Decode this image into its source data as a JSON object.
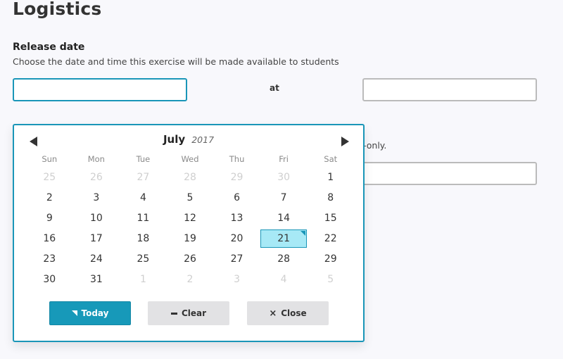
{
  "page": {
    "title": "Logistics"
  },
  "release": {
    "label": "Release date",
    "help": "Choose the date and time this exercise will be made available to students",
    "date_value": "",
    "at_label": "at",
    "time_value": ""
  },
  "hidden_field": {
    "help_suffix": "-only.",
    "value": ""
  },
  "datepicker": {
    "month": "July",
    "year": "2017",
    "weekdays": [
      "Sun",
      "Mon",
      "Tue",
      "Wed",
      "Thu",
      "Fri",
      "Sat"
    ],
    "weeks": [
      [
        {
          "d": "25",
          "muted": true
        },
        {
          "d": "26",
          "muted": true
        },
        {
          "d": "27",
          "muted": true
        },
        {
          "d": "28",
          "muted": true
        },
        {
          "d": "29",
          "muted": true
        },
        {
          "d": "30",
          "muted": true
        },
        {
          "d": "1"
        }
      ],
      [
        {
          "d": "2"
        },
        {
          "d": "3"
        },
        {
          "d": "4"
        },
        {
          "d": "5"
        },
        {
          "d": "6"
        },
        {
          "d": "7"
        },
        {
          "d": "8"
        }
      ],
      [
        {
          "d": "9"
        },
        {
          "d": "10"
        },
        {
          "d": "11"
        },
        {
          "d": "12"
        },
        {
          "d": "13"
        },
        {
          "d": "14"
        },
        {
          "d": "15"
        }
      ],
      [
        {
          "d": "16"
        },
        {
          "d": "17"
        },
        {
          "d": "18"
        },
        {
          "d": "19"
        },
        {
          "d": "20"
        },
        {
          "d": "21",
          "selected": true,
          "today": true
        },
        {
          "d": "22"
        }
      ],
      [
        {
          "d": "23"
        },
        {
          "d": "24"
        },
        {
          "d": "25"
        },
        {
          "d": "26"
        },
        {
          "d": "27"
        },
        {
          "d": "28"
        },
        {
          "d": "29"
        }
      ],
      [
        {
          "d": "30"
        },
        {
          "d": "31"
        },
        {
          "d": "1",
          "muted": true
        },
        {
          "d": "2",
          "muted": true
        },
        {
          "d": "3",
          "muted": true
        },
        {
          "d": "4",
          "muted": true
        },
        {
          "d": "5",
          "muted": true
        }
      ]
    ],
    "buttons": {
      "today": "Today",
      "clear": "Clear",
      "close": "Close"
    },
    "icons": {
      "prev": "triangle-left-icon",
      "next": "triangle-right-icon",
      "today": "corner-triangle-icon",
      "clear": "minus-icon",
      "close": "x-icon"
    },
    "colors": {
      "accent": "#1a96b8",
      "selected_bg": "#a7e9f6",
      "today_button": "#1799b9"
    }
  }
}
